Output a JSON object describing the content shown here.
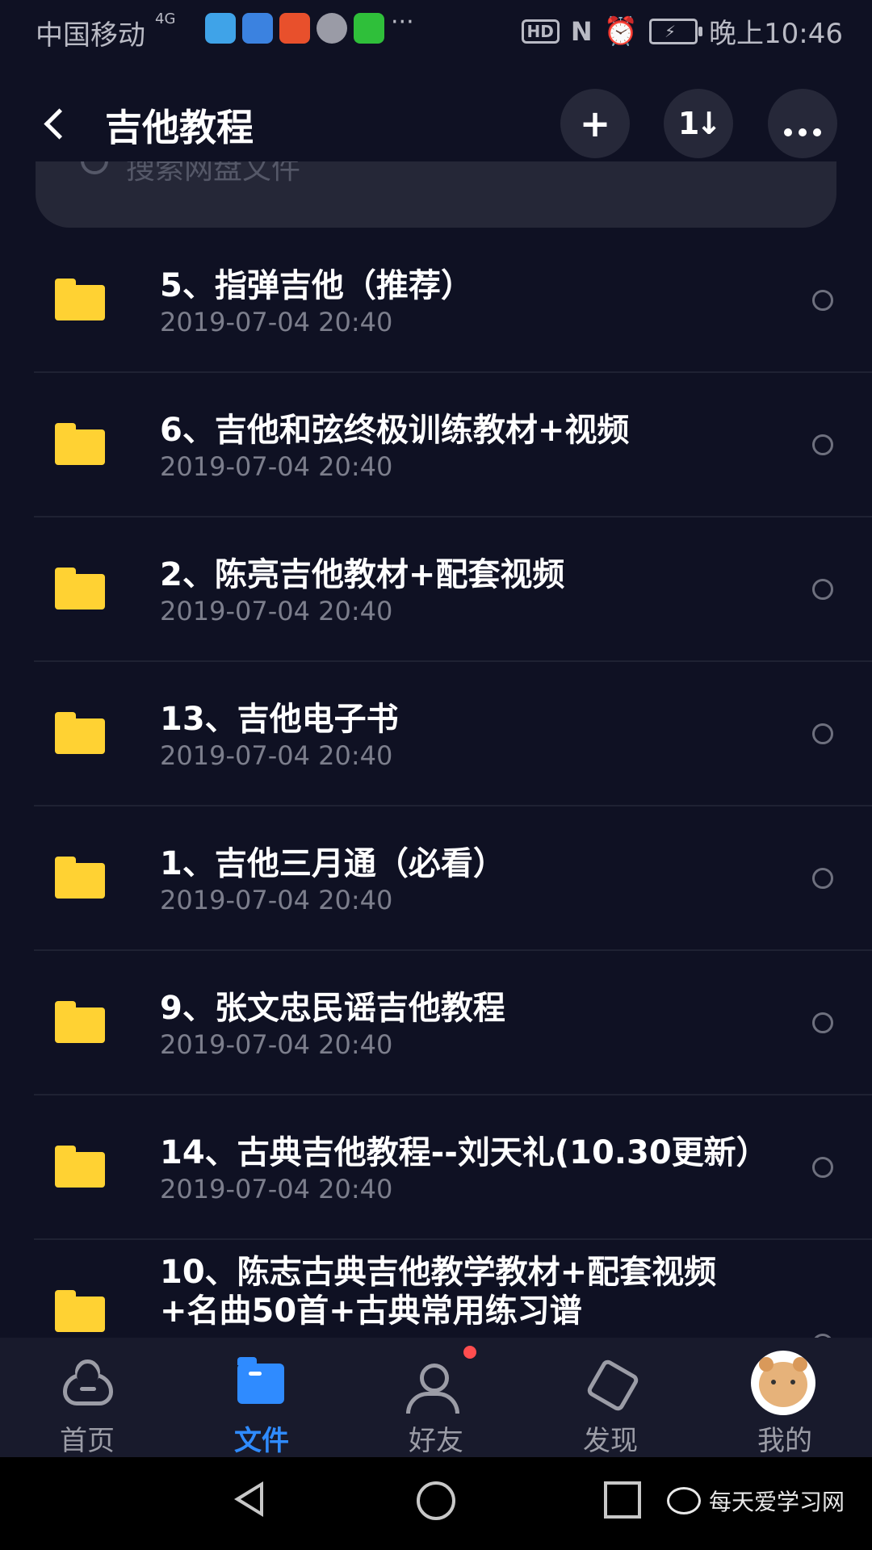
{
  "status_bar": {
    "carrier": "中国移动",
    "network": "4G",
    "more": "···",
    "hd": "HD",
    "nfc": "N",
    "time": "晚上10:46"
  },
  "header": {
    "title": "吉他教程",
    "add": "+",
    "sort": "1↓",
    "more": "···"
  },
  "search": {
    "placeholder": "搜索网盘文件"
  },
  "files": [
    {
      "name": "5、指弹吉他（推荐）",
      "date": "2019-07-04  20:40"
    },
    {
      "name": "6、吉他和弦终极训练教材+视频",
      "date": "2019-07-04  20:40"
    },
    {
      "name": "2、陈亮吉他教材+配套视频",
      "date": "2019-07-04  20:40"
    },
    {
      "name": "13、吉他电子书",
      "date": "2019-07-04  20:40"
    },
    {
      "name": "1、吉他三月通（必看）",
      "date": "2019-07-04  20:40"
    },
    {
      "name": "9、张文忠民谣吉他教程",
      "date": "2019-07-04  20:40"
    },
    {
      "name": "14、古典吉他教程--刘天礼(10.30更新）",
      "date": "2019-07-04  20:40"
    },
    {
      "name": "10、陈志古典吉他教学教材+配套视频+名曲50首+古典常用练习谱",
      "date": ""
    }
  ],
  "tabs": [
    {
      "label": "首页",
      "icon": "cloud-icon"
    },
    {
      "label": "文件",
      "icon": "folder-icon"
    },
    {
      "label": "好友",
      "icon": "friends-icon"
    },
    {
      "label": "发现",
      "icon": "discover-icon"
    },
    {
      "label": "我的",
      "icon": "avatar"
    }
  ],
  "watermark": "每天爱学习网",
  "colors": {
    "accent": "#2f8bff",
    "folder": "#ffd233",
    "background": "#0f1123",
    "badge": "#ff4d4f"
  }
}
